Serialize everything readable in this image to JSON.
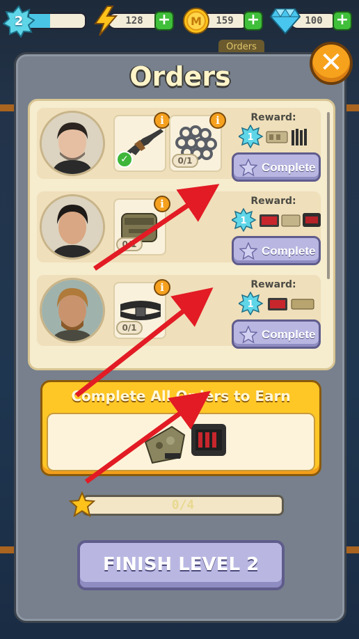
{
  "hud": {
    "level": "2",
    "xp_progress": 0.38,
    "energy": "128",
    "coins": "159",
    "gems": "100",
    "coin_symbol": "M"
  },
  "background": {
    "tab_label": "Orders"
  },
  "modal": {
    "title": "Orders",
    "close_label": "✕"
  },
  "orders": [
    {
      "items": [
        {
          "icon": "rifle-icon",
          "fulfilled": true
        },
        {
          "icon": "chain-coil-icon",
          "count": "0/1"
        }
      ],
      "reward_label": "Reward:",
      "reward_xp": "1",
      "reward_icons": [
        "ammo-pouch-icon",
        "knife-set-icon"
      ],
      "button_label": "Complete"
    },
    {
      "items": [
        {
          "icon": "tactical-pouch-icon",
          "count": "0/1"
        }
      ],
      "reward_label": "Reward:",
      "reward_xp": "1",
      "reward_icons": [
        "toolbox-red-icon",
        "ammo-pouch-icon",
        "tool-case-icon"
      ],
      "button_label": "Complete"
    },
    {
      "items": [
        {
          "icon": "belt-icon",
          "count": "0/1"
        }
      ],
      "reward_label": "Reward:",
      "reward_xp": "1",
      "reward_icons": [
        "toolbox-red-icon",
        "ammo-belt-icon"
      ],
      "button_label": "Complete"
    }
  ],
  "bonus": {
    "title": "Complete All Orders to Earn",
    "reward_icons": [
      "camo-bag-icon",
      "tool-case-icon"
    ]
  },
  "progress": {
    "text": "0/4",
    "value": 0
  },
  "finish_button": "FINISH LEVEL 2",
  "colors": {
    "modal_bg": "#77808c",
    "panel_bg": "#f6ecce",
    "bonus_yellow": "#ffc726",
    "button_purple": "#b9b7e2",
    "close_orange": "#f7a21d",
    "arrow_red": "#e21b24"
  }
}
